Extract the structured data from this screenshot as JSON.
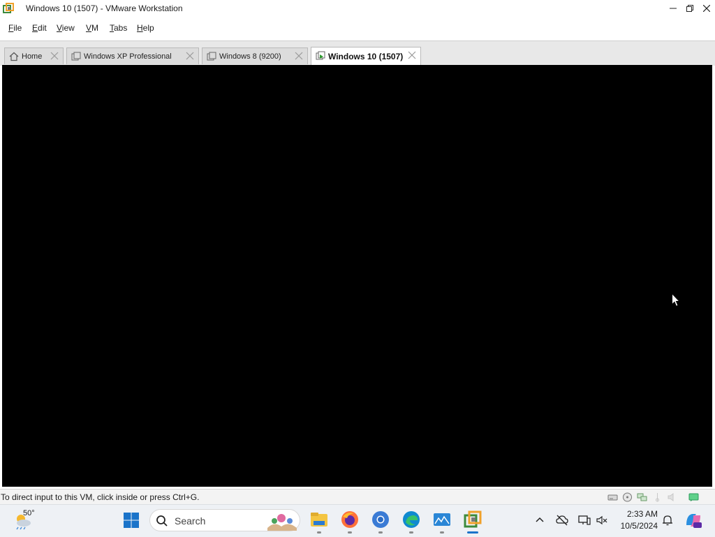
{
  "window": {
    "title": "Windows 10 (1507) - VMware Workstation",
    "controls": [
      "minimize",
      "restore",
      "close"
    ]
  },
  "menubar": {
    "items": [
      {
        "accel": "F",
        "rest": "ile"
      },
      {
        "accel": "E",
        "rest": "dit"
      },
      {
        "accel": "V",
        "rest": "iew"
      },
      {
        "accel": "V",
        "rest": "M"
      },
      {
        "accel": "T",
        "rest": "abs"
      },
      {
        "accel": "H",
        "rest": "elp"
      }
    ]
  },
  "tabs": [
    {
      "label": "Home",
      "icon": "home-icon",
      "active": false
    },
    {
      "label": "Windows XP Professional",
      "icon": "vm-icon",
      "active": false
    },
    {
      "label": "Windows 8 (9200)",
      "icon": "vm-icon",
      "active": false
    },
    {
      "label": "Windows 10 (1507)",
      "icon": "vm-running-icon",
      "active": true
    }
  ],
  "vm_screen": {
    "background": "#000000"
  },
  "statusbar": {
    "text": "To direct input to this VM, click inside or press Ctrl+G.",
    "icons": [
      "hard-disk-icon",
      "cd-icon",
      "network-icon",
      "usb-icon",
      "sound-icon",
      "message-icon"
    ]
  },
  "taskbar": {
    "weather": {
      "temp": "50°",
      "icon": "weather-icon"
    },
    "search": {
      "placeholder": "Search"
    },
    "apps": [
      "file-explorer-icon",
      "firefox-icon",
      "chrome-icon",
      "edge-icon",
      "photos-icon",
      "vmware-icon"
    ],
    "tray": [
      "chevron-up-icon",
      "cloud-off-icon",
      "display-icon",
      "audio-icon"
    ],
    "clock": {
      "time": "2:33 AM",
      "date": "10/5/2024"
    }
  },
  "colors": {
    "accent": "#1a73c9",
    "tab_strip": "#e8e8e8",
    "vm_background": "#000000",
    "taskbar": "#eef1f5"
  }
}
